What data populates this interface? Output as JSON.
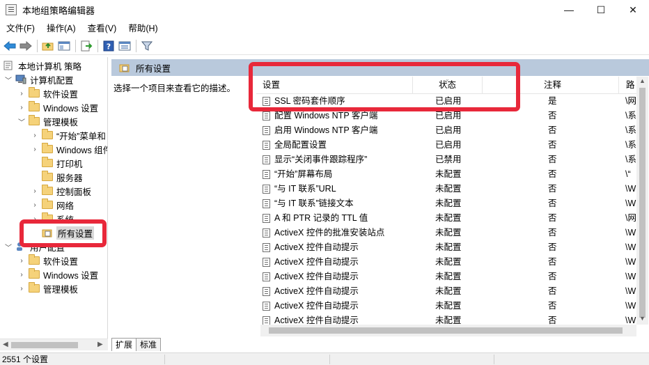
{
  "window": {
    "title": "本地组策略编辑器",
    "controls": {
      "minimize": "—",
      "maximize": "☐",
      "close": "✕"
    }
  },
  "menu": [
    "文件(F)",
    "操作(A)",
    "查看(V)",
    "帮助(H)"
  ],
  "tree": {
    "root": "本地计算机 策略",
    "computer_config": "计算机配置",
    "software_settings": "软件设置",
    "windows_settings": "Windows 设置",
    "admin_templates": "管理模板",
    "start_menu": "“开始”菜单和",
    "windows_components": "Windows 组件",
    "printers": "打印机",
    "server": "服务器",
    "control_panel": "控制面板",
    "network": "网络",
    "system": "系统",
    "all_settings": "所有设置",
    "user_config": "用户配置",
    "user_software_settings": "软件设置",
    "user_windows_settings": "Windows 设置",
    "user_admin_templates": "管理模板"
  },
  "right_pane": {
    "header": "所有设置",
    "description": "选择一个项目来查看它的描述。",
    "columns": {
      "setting": "设置",
      "state": "状态",
      "comment": "注释",
      "path": "路"
    },
    "rows": [
      {
        "setting": "SSL 密码套件顺序",
        "state": "已启用",
        "comment": "是",
        "path": "\\网"
      },
      {
        "setting": "配置 Windows NTP 客户端",
        "state": "已启用",
        "comment": "否",
        "path": "\\系"
      },
      {
        "setting": "启用 Windows NTP 客户端",
        "state": "已启用",
        "comment": "否",
        "path": "\\系"
      },
      {
        "setting": "全局配置设置",
        "state": "已启用",
        "comment": "否",
        "path": "\\系"
      },
      {
        "setting": "显示“关闭事件跟踪程序”",
        "state": "已禁用",
        "comment": "否",
        "path": "\\系"
      },
      {
        "setting": "“开始”屏幕布局",
        "state": "未配置",
        "comment": "否",
        "path": "\\“"
      },
      {
        "setting": "“与 IT 联系”URL",
        "state": "未配置",
        "comment": "否",
        "path": "\\W"
      },
      {
        "setting": "“与 IT 联系”链接文本",
        "state": "未配置",
        "comment": "否",
        "path": "\\W"
      },
      {
        "setting": "A 和 PTR 记录的 TTL 值",
        "state": "未配置",
        "comment": "否",
        "path": "\\网"
      },
      {
        "setting": "ActiveX 控件的批准安装站点",
        "state": "未配置",
        "comment": "否",
        "path": "\\W"
      },
      {
        "setting": "ActiveX 控件自动提示",
        "state": "未配置",
        "comment": "否",
        "path": "\\W"
      },
      {
        "setting": "ActiveX 控件自动提示",
        "state": "未配置",
        "comment": "否",
        "path": "\\W"
      },
      {
        "setting": "ActiveX 控件自动提示",
        "state": "未配置",
        "comment": "否",
        "path": "\\W"
      },
      {
        "setting": "ActiveX 控件自动提示",
        "state": "未配置",
        "comment": "否",
        "path": "\\W"
      },
      {
        "setting": "ActiveX 控件自动提示",
        "state": "未配置",
        "comment": "否",
        "path": "\\W"
      },
      {
        "setting": "ActiveX 控件自动提示",
        "state": "未配置",
        "comment": "否",
        "path": "\\W"
      }
    ]
  },
  "tabs": [
    "扩展",
    "标准"
  ],
  "status": "2551 个设置",
  "colors": {
    "highlight": "#e8283a",
    "pane_header": "#b9c9dc"
  }
}
